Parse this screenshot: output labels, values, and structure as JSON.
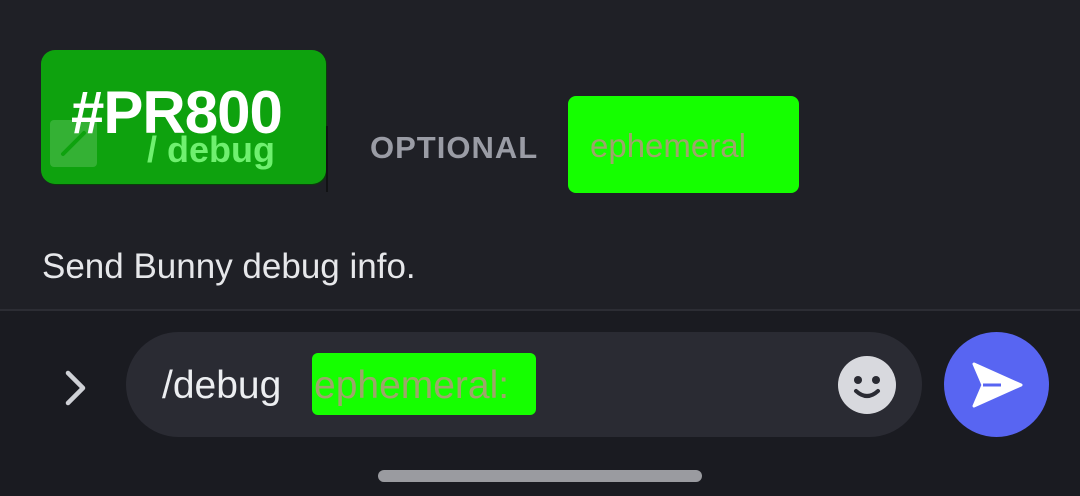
{
  "suggestion": {
    "badge_text": "#PR800",
    "command_name": "/ debug",
    "optional_label": "OPTIONAL",
    "option_name": "ephemeral",
    "description": "Send Bunny debug info."
  },
  "composer": {
    "command_text": "/debug",
    "option_text": "ephemeral:"
  },
  "colors": {
    "background": "#1f2026",
    "badge_green": "#0ea20e",
    "highlight_green": "#15ff00",
    "send_button": "#5865f2"
  },
  "icons": {
    "command": "slash-command-icon",
    "expand": "chevron-right-icon",
    "emoji": "smiley-face-icon",
    "send": "send-arrow-icon"
  }
}
